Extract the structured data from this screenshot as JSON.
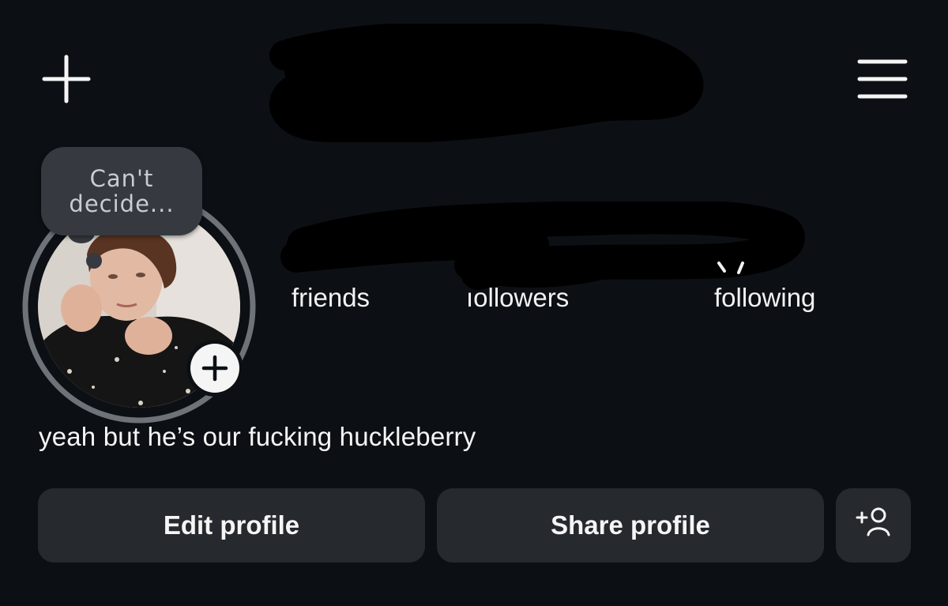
{
  "header": {
    "new_post_icon": "plus-icon",
    "menu_icon": "hamburger-menu-icon",
    "username_redacted": true
  },
  "note": {
    "text_line1": "Can't",
    "text_line2": "decide..."
  },
  "avatar": {
    "add_story_icon": "plus-circle-icon"
  },
  "stats": {
    "friends_label": "friends",
    "followers_label": "ıollowers",
    "following_label": "following"
  },
  "bio": {
    "text": "yeah but he’s our fucking huckleberry"
  },
  "actions": {
    "edit_label": "Edit profile",
    "share_label": "Share profile",
    "add_person_icon": "add-person-icon"
  },
  "colors": {
    "background": "#0c1014",
    "button_bg": "#26292e",
    "note_bg": "#363a40",
    "ring": "#6e737a",
    "text": "#f5f5f5"
  }
}
